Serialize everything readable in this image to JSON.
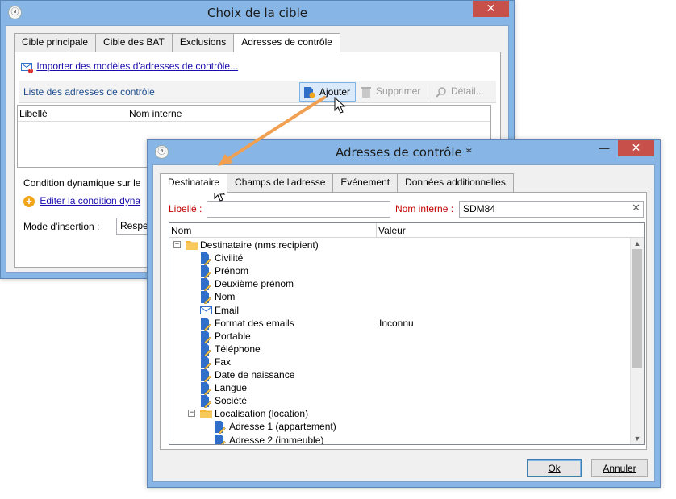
{
  "back_window": {
    "title": "Choix de la cible",
    "close_glyph": "✕",
    "tabs": [
      "Cible principale",
      "Cible des BAT",
      "Exclusions",
      "Adresses de contrôle"
    ],
    "active_tab": "Adresses de contrôle",
    "import_link": "Importer des modèles d'adresses de contrôle...",
    "list_title": "Liste des adresses de contrôle",
    "toolbar": {
      "add": "Ajouter",
      "delete": "Supprimer",
      "detail": "Détail..."
    },
    "grid_columns": [
      "Libellé",
      "Nom interne"
    ],
    "condition_label": "Condition dynamique sur le",
    "edit_condition_link": "Editer la condition dyna",
    "insertion_label": "Mode d'insertion :",
    "insertion_value": "Respec"
  },
  "front_window": {
    "title": "Adresses de contrôle *",
    "minimize_glyph": "—",
    "close_glyph": "✕",
    "tabs": [
      "Destinataire",
      "Champs de l'adresse",
      "Evénement",
      "Données additionnelles"
    ],
    "active_tab": "Destinataire",
    "libelle_label": "Libellé :",
    "libelle_value": "",
    "internal_name_label": "Nom interne :",
    "internal_name_value": "SDM84",
    "clear_glyph": "✕",
    "tree_columns": {
      "name": "Nom",
      "value": "Valeur"
    },
    "tree": [
      {
        "label": "Destinataire (nms:recipient)",
        "value": "",
        "icon": "folder-icon",
        "level": 0,
        "expander": "−"
      },
      {
        "label": "Civilité",
        "value": "",
        "icon": "document-edit-icon",
        "level": 1
      },
      {
        "label": "Prénom",
        "value": "",
        "icon": "document-edit-icon",
        "level": 1
      },
      {
        "label": "Deuxième prénom",
        "value": "",
        "icon": "document-edit-icon",
        "level": 1
      },
      {
        "label": "Nom",
        "value": "",
        "icon": "document-edit-icon",
        "level": 1
      },
      {
        "label": "Email",
        "value": "",
        "icon": "envelope-icon",
        "level": 1
      },
      {
        "label": "Format des emails",
        "value": "Inconnu",
        "icon": "document-edit-icon",
        "level": 1
      },
      {
        "label": "Portable",
        "value": "",
        "icon": "document-edit-icon",
        "level": 1
      },
      {
        "label": "Téléphone",
        "value": "",
        "icon": "document-edit-icon",
        "level": 1
      },
      {
        "label": "Fax",
        "value": "",
        "icon": "document-edit-icon",
        "level": 1
      },
      {
        "label": "Date de naissance",
        "value": "",
        "icon": "document-edit-icon",
        "level": 1
      },
      {
        "label": "Langue",
        "value": "",
        "icon": "document-edit-icon",
        "level": 1
      },
      {
        "label": "Société",
        "value": "",
        "icon": "document-edit-icon",
        "level": 1
      },
      {
        "label": "Localisation (location)",
        "value": "",
        "icon": "folder-icon",
        "level": 1,
        "expander": "−"
      },
      {
        "label": "Adresse 1 (appartement)",
        "value": "",
        "icon": "document-edit-icon",
        "level": 2
      },
      {
        "label": "Adresse 2 (immeuble)",
        "value": "",
        "icon": "document-edit-icon",
        "level": 2
      }
    ],
    "ok_label": "Ok",
    "cancel_label": "Annuler"
  },
  "colors": {
    "title_bar": "#87b6e6",
    "close_button": "#c7504a",
    "link": "#1a0dab",
    "required_label": "#c00000",
    "callout_arrow": "#f0a050"
  }
}
